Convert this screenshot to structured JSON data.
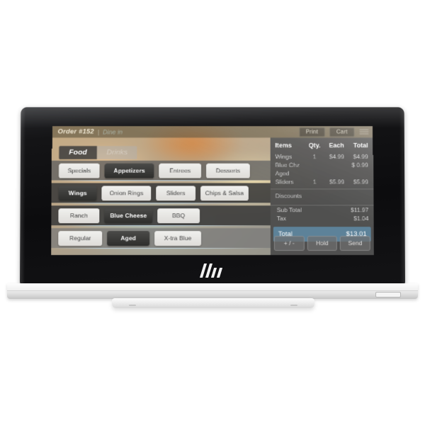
{
  "device": {
    "brand_logo": "hp-logo",
    "base_port": "port-icon"
  },
  "app": {
    "order_bar": {
      "order_id": "Order #152",
      "separator": "|",
      "order_type": "Dine in",
      "print_label": "Print",
      "cart_label": "Cart",
      "menu_icon": "hamburger-menu-icon"
    },
    "tabs": [
      {
        "label": "Food",
        "selected": true
      },
      {
        "label": "Drinks",
        "selected": false
      }
    ],
    "categories": [
      {
        "label": "Specials",
        "selected": false
      },
      {
        "label": "Appetizers",
        "selected": true
      },
      {
        "label": "Entrees",
        "selected": false
      },
      {
        "label": "Desserts",
        "selected": false
      }
    ],
    "items": [
      {
        "label": "Wings",
        "selected": true
      },
      {
        "label": "Onion Rings",
        "selected": false
      },
      {
        "label": "Sliders",
        "selected": false
      },
      {
        "label": "Chips & Salsa",
        "selected": false
      }
    ],
    "sauces": [
      {
        "label": "Ranch",
        "selected": false
      },
      {
        "label": "Blue Cheese",
        "selected": true
      },
      {
        "label": "BBQ",
        "selected": false
      }
    ],
    "styles": [
      {
        "label": "Regular",
        "selected": false
      },
      {
        "label": "Aged",
        "selected": true
      },
      {
        "label": "X-tra Blue",
        "selected": false
      }
    ],
    "ticket": {
      "columns": {
        "item": "Items",
        "qty": "Qty.",
        "each": "Each",
        "total": "Total"
      },
      "lines": [
        {
          "item": "Wings",
          "qty": "1",
          "each": "$4.99",
          "total": "$4.99"
        },
        {
          "item": "Blue Chz",
          "qty": "",
          "each": "",
          "total": "$ 0.99"
        },
        {
          "item": "Aged",
          "qty": "",
          "each": "",
          "total": ""
        },
        {
          "item": "Sliders",
          "qty": "1",
          "each": "$5.99",
          "total": "$5.99"
        }
      ],
      "discounts_label": "Discounts",
      "sub_total_label": "Sub Total",
      "sub_total_value": "$11.97",
      "tax_label": "Tax",
      "tax_value": "$1.04",
      "total_label": "Total",
      "total_value": "$13.01",
      "total_highlight_color": "#5d8299",
      "actions": [
        {
          "label": "+ / -"
        },
        {
          "label": "Hold"
        },
        {
          "label": "Send"
        }
      ]
    }
  }
}
